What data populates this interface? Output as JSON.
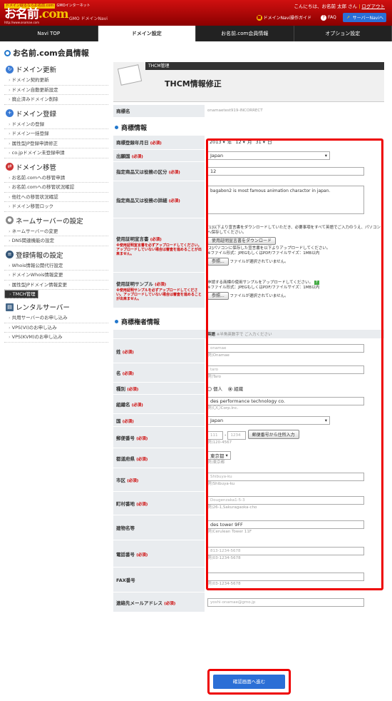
{
  "header": {
    "logo_tag": "ドメイン取るならお名前.com",
    "logo_tag2": "GMOインターネット",
    "logo_name_a": "お名前",
    "logo_name_b": ".com",
    "logo_url": "http://www.onamae.com",
    "logo_gmo": "GMO",
    "logo_sub": "ドメインNavi",
    "greeting": "こんにちは、お名前 太郎 さん",
    "logout": "ログアウト",
    "links": [
      {
        "icon": "book-icon",
        "label": "ドメインNavi操作ガイド"
      },
      {
        "icon": "question-icon",
        "label": "FAQ"
      },
      {
        "icon": "arrow-icon",
        "label": "サーバーNaviへ"
      }
    ]
  },
  "nav": {
    "tabs": [
      "Navi TOP",
      "ドメイン設定",
      "お名前.com会員情報",
      "オプション設定"
    ],
    "active": 1
  },
  "sidebar": {
    "title": "お名前.com会員情報",
    "sections": [
      {
        "title": "ドメイン更新",
        "icon": "refresh-icon",
        "items": [
          "ドメイン契約更新",
          "ドメイン自動更新設定",
          "廃止済みドメイン削除"
        ]
      },
      {
        "title": "ドメイン登録",
        "icon": "plus-icon",
        "items": [
          "ドメインの登録",
          "ドメイン一括登録",
          "属性型JP登録申請修正",
          "co.jpドメイン未登録申請"
        ]
      },
      {
        "title": "ドメイン移管",
        "icon": "transfer-icon",
        "items": [
          "お名前.comへの移管申請",
          "お名前.comへの移管状況確認",
          "他社への移管状況確認",
          "ドメイン移管ロック"
        ]
      },
      {
        "title": "ネームサーバーの設定",
        "icon": "user-icon",
        "items": [
          "ネームサーバーの変更",
          "DNS関連機能の設定"
        ]
      },
      {
        "title": "登録情報の設定",
        "icon": "database-icon",
        "items": [
          "Whois情報公開代行設定",
          "ドメインWhois情報変更",
          "属性型JPドメイン情報変更",
          "TMCH管理"
        ]
      },
      {
        "title": "レンタルサーバー",
        "icon": "server-icon",
        "items": [
          "共用サーバーのお申し込み",
          "VPS(VI)のお申し込み",
          "VPS(KVM)のお申し込み"
        ]
      }
    ],
    "selected": "TMCH管理"
  },
  "main": {
    "header_label": "THCM管理",
    "title": "THCM情報修正",
    "trademark_name_label": "商標名",
    "trademark_name_value": "onamaetest919-INCORRECT",
    "section1": "商標情報",
    "reg_date_label": "商標登録年月日",
    "reg_year": "2013",
    "reg_month": "12",
    "reg_day": "31",
    "unit_year": "年",
    "unit_month": "月",
    "unit_day": "日",
    "country_label": "出願国",
    "country_value": "Japan",
    "class_label": "指定商品又は役務の区分",
    "class_value": "12",
    "detail_label": "指定商品又は役務の詳細",
    "detail_value": "bagabon2 is most famous animation charactor in japan.",
    "usage_cert_label": "使用証明宣言書",
    "usage_cert_note": "※使用証明宣言書を必ずアップロードしてください。アップロードしていない場合は審査を進めることが出来ません。",
    "usage_cert_text1": "[1]以下より宣言書をダウンロードしていただき、必要事項をすべて英語でご入力のうえ、パソコンへ保存してください。",
    "usage_cert_download": "使用証明宣言書をダウンロード",
    "usage_cert_text2": "[2]パソコンに保存した宣言書を以下よりアップロードしてください。",
    "usage_cert_text3": "※ファイル形式：JPEGもしくはPDF/ファイルサイズ：1MB以内",
    "browse": "参照...",
    "no_file": "ファイルが選択されていません。",
    "sample_label": "使用証明サンプル",
    "sample_note": "※使用証明サンプルを必ずアップロードしてください。アップロードしていない場合は審査を進めることが出来ません。",
    "sample_text1": "申請する商標の使用サンプルをアップロードしてください。",
    "sample_badge": "?",
    "sample_text2": "※ファイル形式：JPEGもしくはPDF/ファイルサイズ：1MB以内",
    "required": "(必須)",
    "section2": "商標権者情報",
    "lang_note_a": "英語",
    "lang_note_b": "※半角英数字で ご入力ください",
    "rows": [
      {
        "label": "姓",
        "req": true,
        "value": "onamae",
        "hint": "例)Onamae",
        "kind": "input"
      },
      {
        "label": "名",
        "req": true,
        "value": "taro",
        "hint": "例)Taro",
        "kind": "input"
      },
      {
        "label": "種別",
        "req": true,
        "kind": "radio",
        "opt1": "個人",
        "opt2": "組織"
      },
      {
        "label": "組織名",
        "req": true,
        "value": "des performance technology co.",
        "hint": "例)〇〇Corp.Inc.",
        "kind": "input"
      },
      {
        "label": "国",
        "req": true,
        "value": "Japan",
        "kind": "select"
      },
      {
        "label": "郵便番号",
        "req": true,
        "value1": "111",
        "value2": "1234",
        "hint": "例)120-4567",
        "button": "郵便番号から住所入力",
        "kind": "zip"
      },
      {
        "label": "都道府県",
        "req": true,
        "value": "東京都",
        "hint": "例)東京都",
        "kind": "pref"
      },
      {
        "label": "市区",
        "req": true,
        "value": "Shibuya-ku",
        "hint": "例)Shibuya-ku",
        "kind": "input"
      },
      {
        "label": "町村番地",
        "req": true,
        "value": "Dougenzaka1-5-3",
        "hint": "例)26-1,Sakuragaoka-cho",
        "kind": "input"
      },
      {
        "label": "建物名等",
        "req": false,
        "value": "des tower 9FF",
        "hint": "例)Cerulean Tower 11F",
        "kind": "input"
      },
      {
        "label": "電話番号",
        "req": true,
        "value": "813-1234-5678",
        "hint": "例)03-1234-5678",
        "kind": "input"
      },
      {
        "label": "FAX番号",
        "req": false,
        "value": "",
        "hint": "例)03-1234-5678",
        "kind": "input"
      },
      {
        "label": "連絡先メールアドレス",
        "req": true,
        "value": "yoshi-onamae@gmo.jp",
        "hint": "",
        "kind": "input"
      }
    ],
    "confirm": "確認画面へ進む"
  }
}
